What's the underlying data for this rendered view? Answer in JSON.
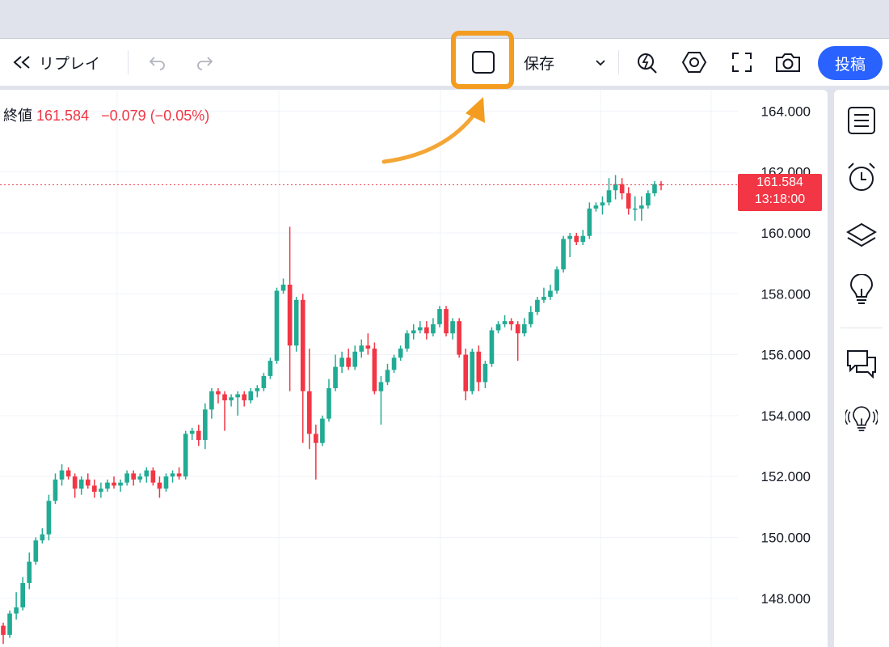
{
  "toolbar": {
    "replay_label": "リプレイ",
    "save_label": "保存",
    "publish_label": "投稿",
    "icons": {
      "replay": "rewind-icon",
      "undo": "undo-icon",
      "redo": "redo-icon",
      "layout": "square-layout-icon",
      "save_dropdown": "chevron-down-icon",
      "quick_search": "lightning-search-icon",
      "settings": "hexagon-settings-icon",
      "fullscreen": "fullscreen-icon",
      "snapshot": "camera-icon"
    }
  },
  "legend": {
    "label": "終値",
    "close": "161.584",
    "change": "−0.079",
    "change_pct": "(−0.05%)"
  },
  "price_tag": {
    "price": "161.584",
    "countdown": "13:18:00"
  },
  "right_panel": {
    "icons": [
      "watchlist-icon",
      "alarm-clock-icon",
      "layers-icon",
      "lightbulb-icon",
      "chat-icon",
      "streaming-lightbulb-icon"
    ]
  },
  "colors": {
    "up": "#22ab94",
    "down": "#f23645",
    "accent": "#2962ff",
    "highlight": "#f39c1f"
  },
  "chart_data": {
    "type": "candlestick",
    "last_price": 161.584,
    "y_ticks": [
      "164.000",
      "162.000",
      "160.000",
      "158.000",
      "156.000",
      "154.000",
      "152.000",
      "150.000",
      "148.000"
    ],
    "ylim": [
      146.4,
      164.7
    ],
    "candles": [
      [
        147.1,
        146.8,
        147.2,
        146.5
      ],
      [
        146.8,
        147.5,
        147.6,
        146.7
      ],
      [
        147.5,
        147.7,
        148.2,
        147.3
      ],
      [
        147.7,
        148.5,
        148.7,
        147.6
      ],
      [
        148.5,
        149.2,
        149.5,
        148.3
      ],
      [
        149.2,
        149.9,
        150.0,
        149.1
      ],
      [
        149.9,
        150.1,
        150.3,
        149.8
      ],
      [
        150.1,
        151.2,
        151.4,
        149.9
      ],
      [
        151.2,
        151.9,
        152.1,
        151.1
      ],
      [
        151.9,
        152.2,
        152.4,
        151.7
      ],
      [
        152.2,
        152.0,
        152.3,
        151.9
      ],
      [
        152.0,
        151.6,
        152.1,
        151.3
      ],
      [
        151.6,
        151.9,
        152.0,
        151.4
      ],
      [
        151.9,
        151.7,
        152.1,
        151.6
      ],
      [
        151.7,
        151.5,
        151.9,
        151.3
      ],
      [
        151.5,
        151.6,
        151.8,
        151.3
      ],
      [
        151.6,
        151.8,
        151.9,
        151.5
      ],
      [
        151.8,
        151.7,
        152.0,
        151.6
      ],
      [
        151.7,
        151.8,
        151.9,
        151.5
      ],
      [
        151.8,
        152.1,
        152.2,
        151.7
      ],
      [
        152.1,
        151.9,
        152.2,
        151.7
      ],
      [
        151.9,
        152.0,
        152.1,
        151.8
      ],
      [
        152.0,
        152.2,
        152.3,
        151.8
      ],
      [
        152.2,
        151.8,
        152.3,
        151.7
      ],
      [
        151.8,
        151.6,
        152.0,
        151.3
      ],
      [
        151.6,
        152.0,
        152.1,
        151.5
      ],
      [
        152.0,
        152.1,
        152.2,
        151.8
      ],
      [
        152.1,
        152.0,
        152.3,
        151.9
      ],
      [
        152.0,
        153.4,
        153.5,
        151.9
      ],
      [
        153.4,
        153.5,
        153.6,
        153.2
      ],
      [
        153.5,
        153.2,
        153.7,
        153.0
      ],
      [
        153.2,
        154.2,
        154.4,
        152.9
      ],
      [
        154.2,
        154.8,
        154.9,
        153.9
      ],
      [
        154.8,
        154.7,
        154.9,
        154.4
      ],
      [
        154.7,
        154.5,
        154.8,
        153.5
      ],
      [
        154.5,
        154.6,
        154.7,
        154.3
      ],
      [
        154.6,
        154.7,
        154.8,
        154.0
      ],
      [
        154.7,
        154.5,
        154.8,
        154.3
      ],
      [
        154.5,
        154.8,
        154.9,
        154.4
      ],
      [
        154.8,
        154.9,
        155.0,
        154.6
      ],
      [
        154.9,
        155.3,
        155.4,
        154.8
      ],
      [
        155.3,
        155.8,
        155.9,
        155.2
      ],
      [
        155.8,
        158.1,
        158.2,
        155.7
      ],
      [
        158.1,
        158.3,
        158.5,
        158.0
      ],
      [
        158.3,
        156.3,
        160.2,
        154.8
      ],
      [
        156.3,
        157.8,
        157.9,
        156.1
      ],
      [
        157.8,
        154.8,
        158.0,
        153.1
      ],
      [
        154.8,
        153.4,
        156.2,
        152.9
      ],
      [
        153.4,
        153.1,
        153.7,
        151.9
      ],
      [
        153.1,
        153.9,
        154.0,
        153.0
      ],
      [
        153.9,
        154.9,
        155.2,
        153.8
      ],
      [
        154.9,
        155.6,
        156.0,
        154.8
      ],
      [
        155.6,
        155.9,
        156.1,
        155.4
      ],
      [
        155.9,
        155.6,
        156.2,
        155.5
      ],
      [
        155.6,
        156.1,
        156.3,
        155.5
      ],
      [
        156.1,
        156.3,
        156.5,
        155.9
      ],
      [
        156.3,
        156.2,
        156.7,
        156.0
      ],
      [
        156.2,
        154.8,
        156.4,
        154.7
      ],
      [
        154.8,
        155.1,
        155.3,
        153.7
      ],
      [
        155.1,
        155.5,
        155.7,
        155.0
      ],
      [
        155.5,
        155.9,
        156.0,
        155.4
      ],
      [
        155.9,
        156.2,
        156.3,
        155.8
      ],
      [
        156.2,
        156.7,
        156.8,
        156.1
      ],
      [
        156.7,
        156.8,
        157.0,
        156.5
      ],
      [
        156.8,
        156.9,
        157.1,
        156.7
      ],
      [
        156.9,
        156.7,
        157.1,
        156.5
      ],
      [
        156.7,
        157.0,
        157.2,
        156.6
      ],
      [
        157.0,
        157.5,
        157.6,
        156.9
      ],
      [
        157.5,
        156.7,
        157.6,
        156.6
      ],
      [
        156.7,
        157.1,
        157.2,
        156.5
      ],
      [
        157.1,
        156.0,
        157.2,
        155.9
      ],
      [
        156.0,
        154.8,
        156.2,
        154.5
      ],
      [
        154.8,
        156.1,
        156.2,
        154.7
      ],
      [
        156.1,
        155.1,
        156.3,
        154.8
      ],
      [
        155.1,
        155.7,
        155.8,
        154.9
      ],
      [
        155.7,
        156.8,
        156.9,
        155.6
      ],
      [
        156.8,
        157.0,
        157.1,
        156.7
      ],
      [
        157.0,
        157.1,
        157.3,
        156.9
      ],
      [
        157.1,
        157.0,
        157.2,
        156.8
      ],
      [
        157.0,
        156.7,
        157.1,
        155.8
      ],
      [
        156.7,
        157.0,
        157.2,
        156.6
      ],
      [
        157.0,
        157.4,
        157.6,
        156.9
      ],
      [
        157.4,
        157.8,
        157.9,
        157.3
      ],
      [
        157.8,
        157.9,
        158.2,
        157.7
      ],
      [
        157.9,
        158.1,
        158.3,
        157.8
      ],
      [
        158.1,
        158.8,
        158.9,
        158.0
      ],
      [
        158.8,
        159.8,
        159.9,
        158.7
      ],
      [
        159.8,
        159.9,
        160.0,
        159.2
      ],
      [
        159.9,
        159.7,
        160.0,
        159.6
      ],
      [
        159.7,
        159.9,
        160.1,
        159.6
      ],
      [
        159.9,
        160.8,
        161.0,
        159.8
      ],
      [
        160.8,
        160.9,
        161.0,
        160.7
      ],
      [
        160.9,
        161.0,
        161.2,
        160.6
      ],
      [
        161.0,
        161.4,
        161.8,
        160.9
      ],
      [
        161.4,
        161.6,
        161.9,
        161.1
      ],
      [
        161.6,
        161.3,
        161.8,
        161.1
      ],
      [
        161.3,
        160.8,
        161.5,
        160.6
      ],
      [
        160.8,
        160.8,
        161.2,
        160.4
      ],
      [
        160.8,
        160.9,
        161.2,
        160.4
      ],
      [
        160.9,
        161.3,
        161.4,
        160.8
      ],
      [
        161.3,
        161.6,
        161.7,
        161.2
      ],
      [
        161.6,
        161.584,
        161.7,
        161.4
      ]
    ]
  }
}
